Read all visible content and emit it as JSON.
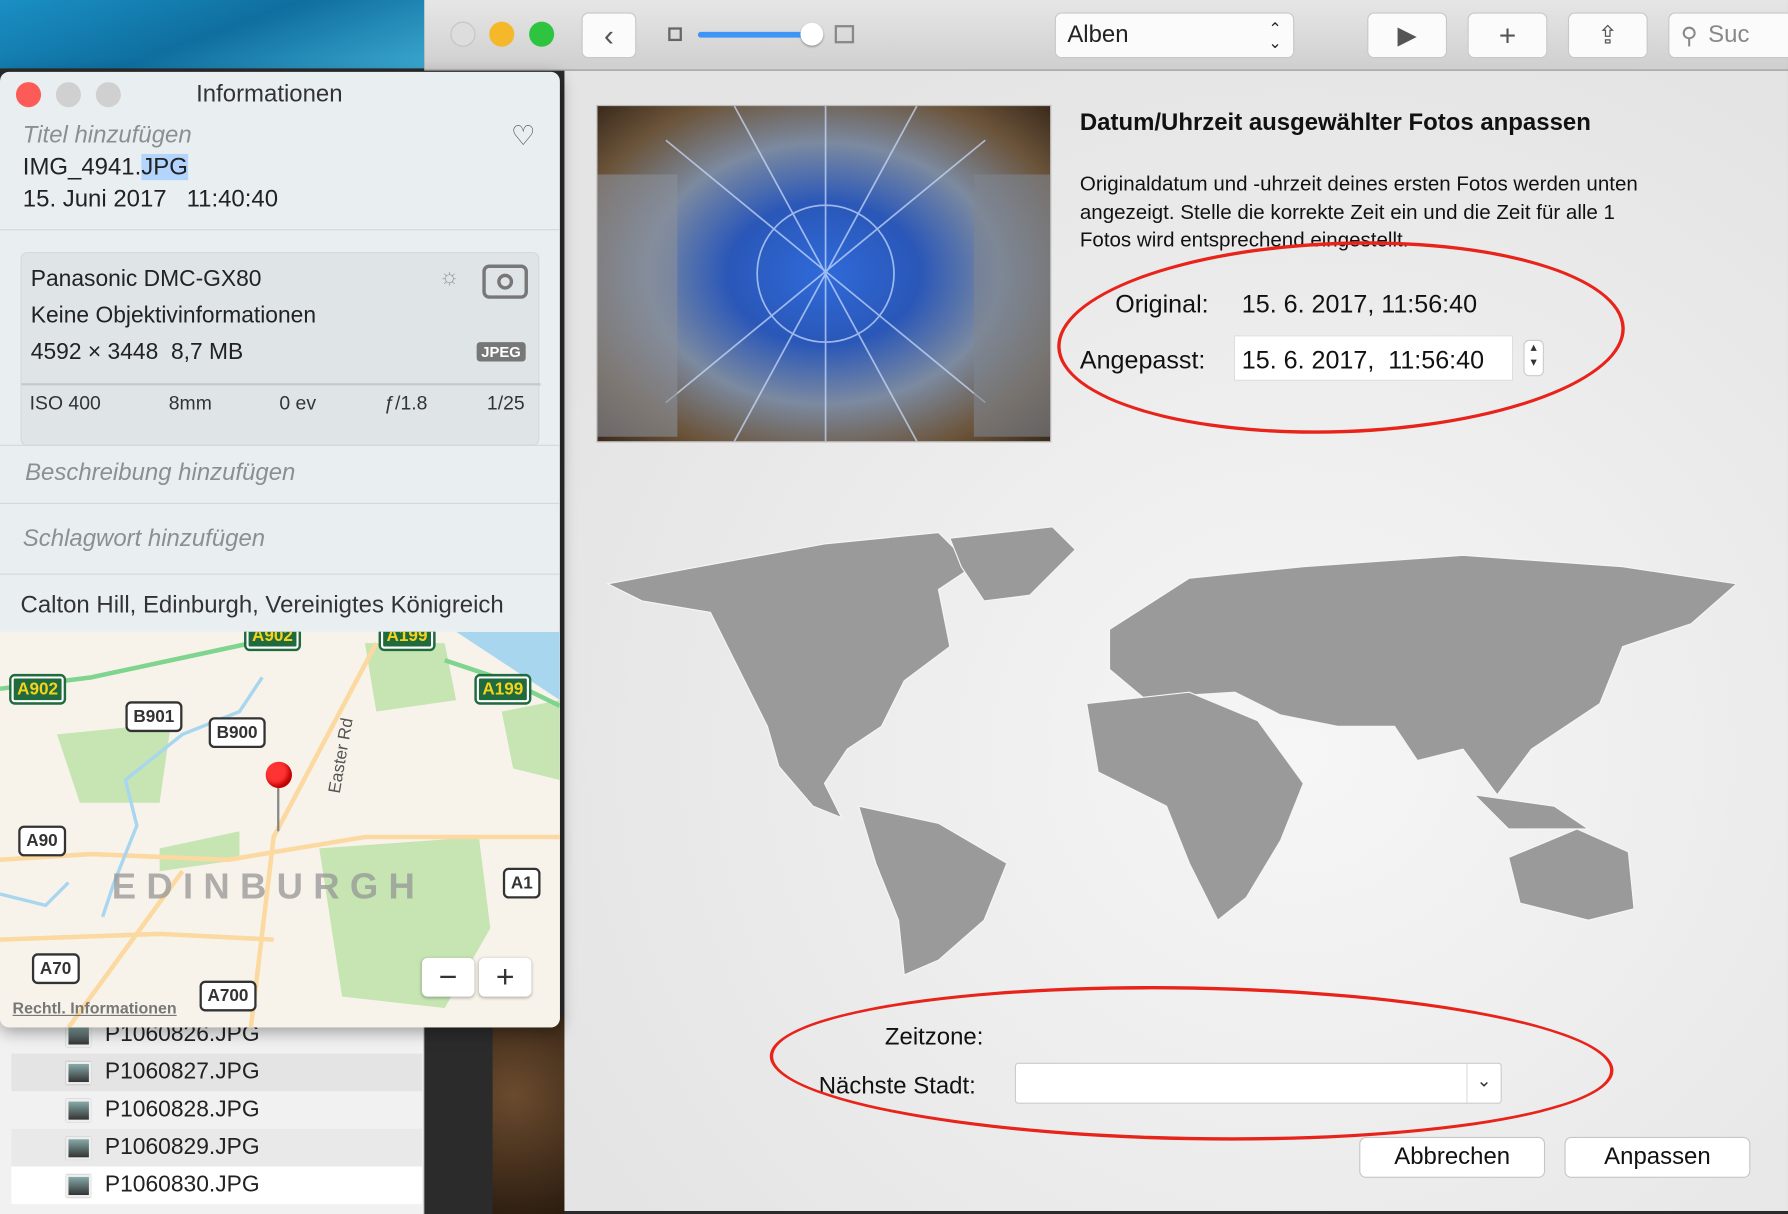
{
  "toolbar": {
    "view_select": "Alben",
    "search_placeholder": "Suc"
  },
  "info": {
    "title": "Informationen",
    "title_placeholder": "Titel hinzufügen",
    "filename_base": "IMG_4941.",
    "filename_ext": "JPG",
    "date": "15. Juni 2017",
    "time": "11:40:40",
    "camera": "Panasonic DMC-GX80",
    "lens": "Keine Objektivinformationen",
    "dimensions": "4592 × 3448",
    "filesize": "8,7 MB",
    "format": "JPEG",
    "exif": {
      "iso": "ISO 400",
      "focal": "8mm",
      "ev": "0 ev",
      "aperture": "ƒ/1.8",
      "shutter": "1/25"
    },
    "description_placeholder": "Beschreibung hinzufügen",
    "keyword_placeholder": "Schlagwort hinzufügen",
    "location": "Calton Hill, Edinburgh, Vereinigtes Königreich"
  },
  "map": {
    "city": "EDINBURGH",
    "street": "Easter Rd",
    "roads": [
      "A902",
      "A199",
      "A902",
      "A199",
      "B901",
      "B900",
      "A90",
      "A1",
      "A70",
      "A700"
    ],
    "legal": "Rechtl. Informationen",
    "zoom_out": "−",
    "zoom_in": "+"
  },
  "files": [
    "P1060826.JPG",
    "P1060827.JPG",
    "P1060828.JPG",
    "P1060829.JPG",
    "P1060830.JPG"
  ],
  "dialog": {
    "heading": "Datum/Uhrzeit ausgewählter Fotos anpassen",
    "description_1": "Originaldatum und -uhrzeit deines ersten Fotos werden unten",
    "description_2": "angezeigt. Stelle die korrekte Zeit ein und die Zeit für alle 1",
    "description_3": "Fotos wird entsprechend eingestellt.",
    "original_label": "Original:",
    "original_value": "15. 6. 2017,  11:56:40",
    "adjusted_label": "Angepasst:",
    "adjusted_value": "15. 6. 2017,  11:56:40",
    "timezone_label": "Zeitzone:",
    "city_label": "Nächste Stadt:",
    "city_value": "",
    "cancel": "Abbrechen",
    "apply": "Anpassen"
  },
  "annotation_color": "#e8231a"
}
